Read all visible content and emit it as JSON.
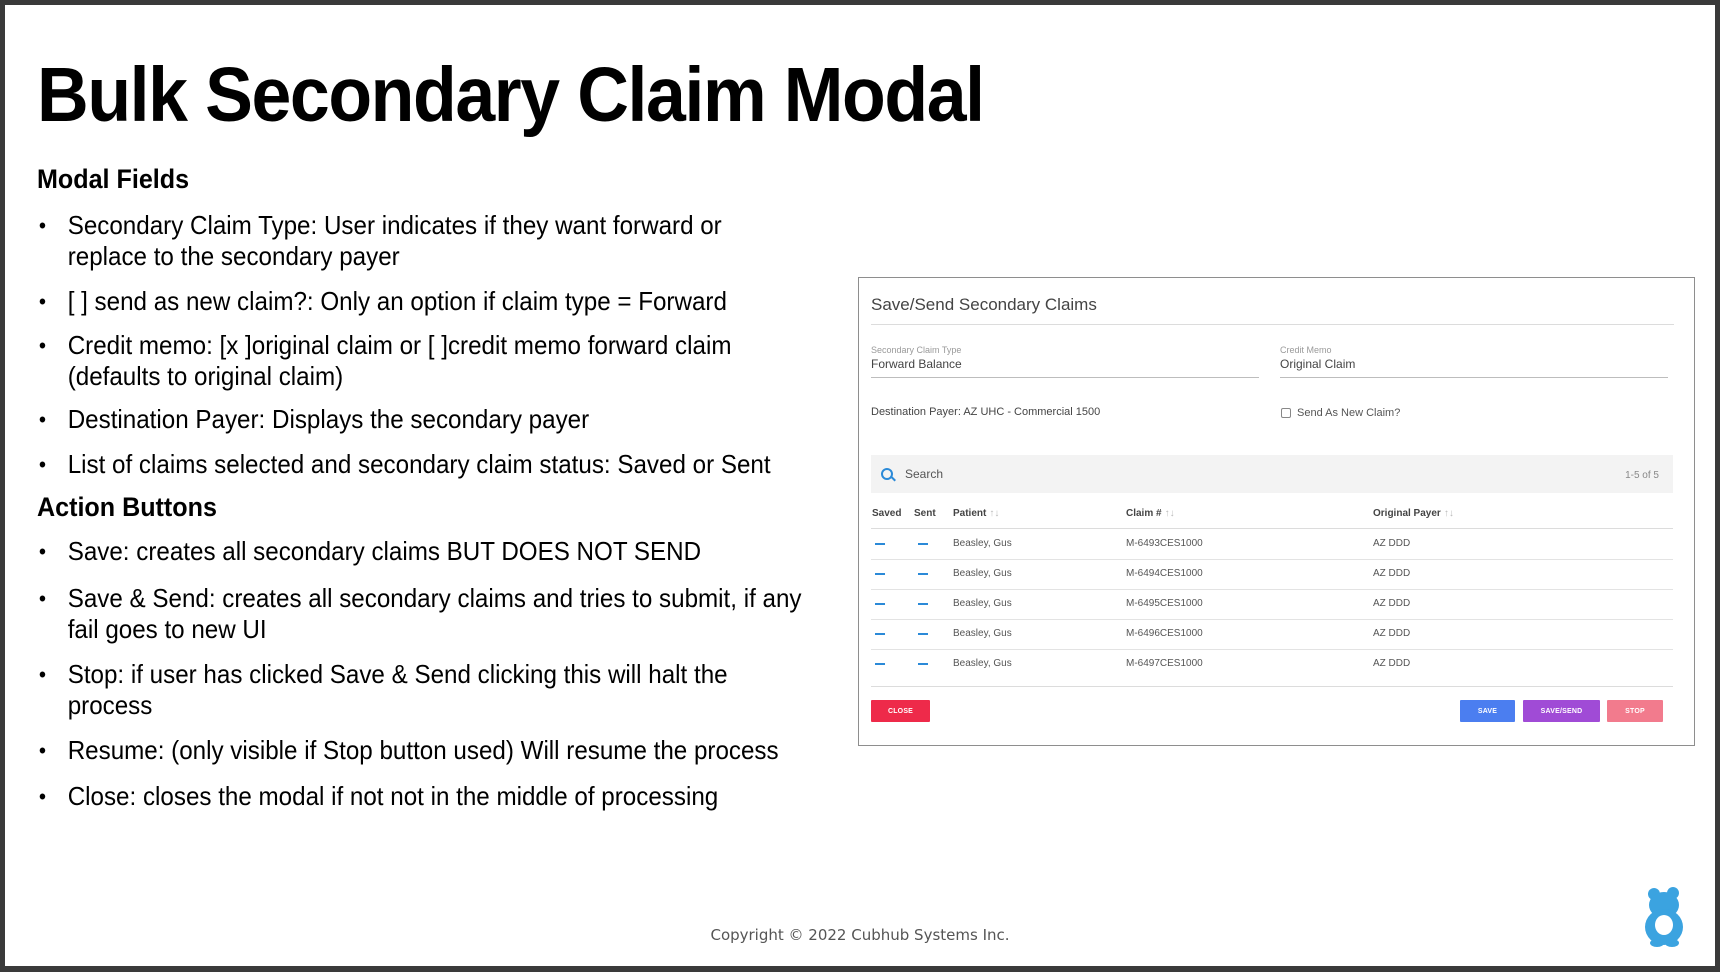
{
  "slide": {
    "title": "Bulk Secondary Claim Modal",
    "sections": [
      {
        "heading": "Modal Fields",
        "bullets": [
          "Secondary Claim Type: User indicates if they want forward or replace to the secondary payer",
          "[ ] send as new claim?: Only an option if claim type = Forward",
          "Credit memo: [x ]original claim or [ ]credit memo forward claim (defaults to original claim)",
          "Destination Payer: Displays the secondary payer",
          "List of claims selected and secondary claim status: Saved or Sent"
        ]
      },
      {
        "heading": "Action Buttons",
        "bullets": [
          "Save: creates all secondary claims BUT DOES NOT SEND",
          "Save & Send: creates all secondary claims and tries to submit, if any fail goes to new UI",
          "Stop: if user has clicked Save & Send clicking this will halt the process",
          "Resume: (only visible if Stop button used) Will resume the process",
          "Close: closes the modal if not not in the middle of processing"
        ]
      }
    ],
    "copyright": "Copyright © 2022 Cubhub Systems Inc.",
    "logo_icon": "bear-cub-logo-icon"
  },
  "modal": {
    "title": "Save/Send Secondary Claims",
    "secondary_claim_type": {
      "label": "Secondary Claim Type",
      "value": "Forward Balance"
    },
    "credit_memo": {
      "label": "Credit Memo",
      "value": "Original Claim"
    },
    "destination_payer": "Destination Payer: AZ UHC - Commercial 1500",
    "send_as_new_claim": {
      "label": "Send As New Claim?",
      "checked": false
    },
    "search": {
      "placeholder": "Search",
      "count": "1-5 of 5"
    },
    "columns": [
      "Saved",
      "Sent",
      "Patient",
      "Claim #",
      "Original Payer"
    ],
    "rows": [
      {
        "saved": "—",
        "sent": "—",
        "patient": "Beasley, Gus",
        "claim": "M-6493CES1000",
        "payer": "AZ DDD"
      },
      {
        "saved": "—",
        "sent": "—",
        "patient": "Beasley, Gus",
        "claim": "M-6494CES1000",
        "payer": "AZ DDD"
      },
      {
        "saved": "—",
        "sent": "—",
        "patient": "Beasley, Gus",
        "claim": "M-6495CES1000",
        "payer": "AZ DDD"
      },
      {
        "saved": "—",
        "sent": "—",
        "patient": "Beasley, Gus",
        "claim": "M-6496CES1000",
        "payer": "AZ DDD"
      },
      {
        "saved": "—",
        "sent": "—",
        "patient": "Beasley, Gus",
        "claim": "M-6497CES1000",
        "payer": "AZ DDD"
      }
    ],
    "buttons": {
      "close": "CLOSE",
      "save": "SAVE",
      "save_send": "SAVE/SEND",
      "stop": "STOP"
    },
    "colors": {
      "close": "#ee2a4a",
      "save": "#4b7ef0",
      "save_send": "#a04bd6",
      "stop": "#f27b8d",
      "accent": "#2b8ad8"
    }
  }
}
